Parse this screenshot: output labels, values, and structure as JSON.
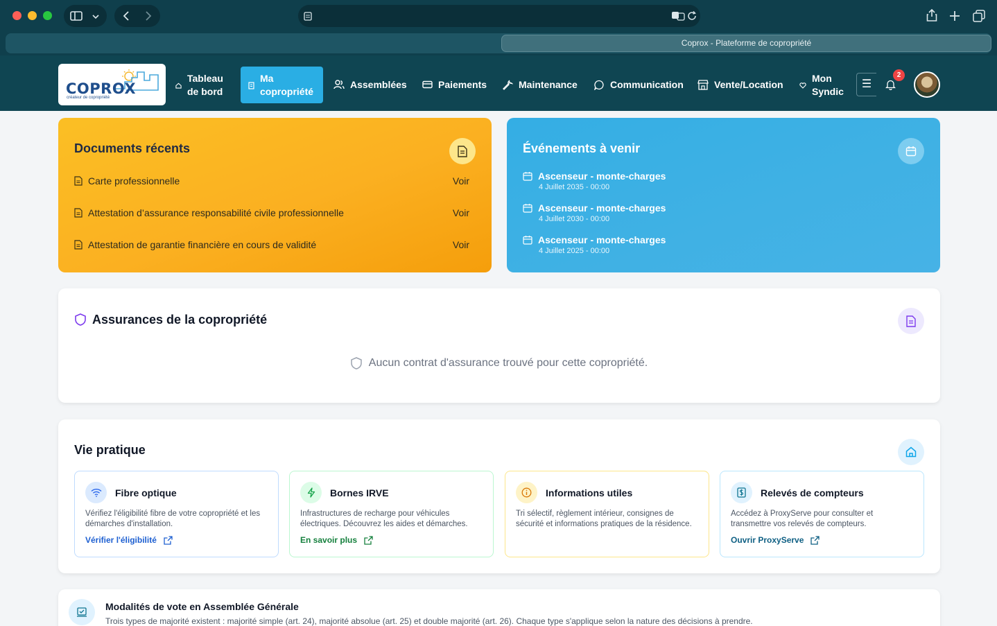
{
  "browser": {
    "tab_title": "Coprox - Plateforme de copropriété"
  },
  "header": {
    "logo_text": "COPROX",
    "logo_tagline": "créateur de copropriété",
    "nav": [
      {
        "label_line1": "Tableau",
        "label_line2": "de bord",
        "icon": "home-icon"
      },
      {
        "label_line1": "Ma",
        "label_line2": "copropriété",
        "icon": "building-icon"
      },
      {
        "label": "Assemblées",
        "icon": "users-icon"
      },
      {
        "label": "Paiements",
        "icon": "credit-card-icon"
      },
      {
        "label": "Maintenance",
        "icon": "wrench-icon"
      },
      {
        "label": "Communication",
        "icon": "chat-bubble-icon"
      },
      {
        "label": "Vente/Location",
        "icon": "store-icon"
      },
      {
        "label_line1": "Mon",
        "label_line2": "Syndic",
        "icon": "heart-icon"
      }
    ],
    "notifications_count": "2"
  },
  "documents": {
    "title": "Documents récents",
    "items": [
      {
        "label": "Carte professionnelle",
        "action": "Voir"
      },
      {
        "label": "Attestation d’assurance responsabilité civile professionnelle",
        "action": "Voir"
      },
      {
        "label": "Attestation de garantie financière en cours de validité",
        "action": "Voir"
      }
    ]
  },
  "events": {
    "title": "Événements à venir",
    "items": [
      {
        "title": "Ascenseur - monte-charges",
        "date": "4 Juillet 2035 - 00:00"
      },
      {
        "title": "Ascenseur - monte-charges",
        "date": "4 Juillet 2030 - 00:00"
      },
      {
        "title": "Ascenseur - monte-charges",
        "date": "4 Juillet 2025 - 00:00"
      }
    ]
  },
  "insurance": {
    "title": "Assurances de la copropriété",
    "empty_text": "Aucun contrat d'assurance trouvé pour cette copropriété."
  },
  "vie_pratique": {
    "title": "Vie pratique",
    "cards": [
      {
        "title": "Fibre optique",
        "description": "Vérifiez l'éligibilité fibre de votre copropriété et les démarches d'installation.",
        "link": "Vérifier l'éligibilité"
      },
      {
        "title": "Bornes IRVE",
        "description": "Infrastructures de recharge pour véhicules électriques. Découvrez les aides et démarches.",
        "link": "En savoir plus"
      },
      {
        "title": "Informations utiles",
        "description": "Tri sélectif, règlement intérieur, consignes de sécurité et informations pratiques de la résidence.",
        "link": ""
      },
      {
        "title": "Relevés de compteurs",
        "description": "Accédez à ProxyServe pour consulter et transmettre vos relevés de compteurs.",
        "link": "Ouvrir ProxyServe"
      }
    ]
  },
  "vote": {
    "title": "Modalités de vote en Assemblée Générale",
    "description": "Trois types de majorité existent : majorité simple (art. 24), majorité absolue (art. 25) et double majorité (art. 26). Chaque type s'applique selon la nature des décisions à prendre."
  },
  "colors": {
    "header_bg": "#0f4552",
    "active_nav": "#2aaee4",
    "documents_card": "#fbbf24",
    "events_card": "#3fb1e4",
    "link_blue": "#1d5fd1",
    "link_green": "#15803d"
  }
}
